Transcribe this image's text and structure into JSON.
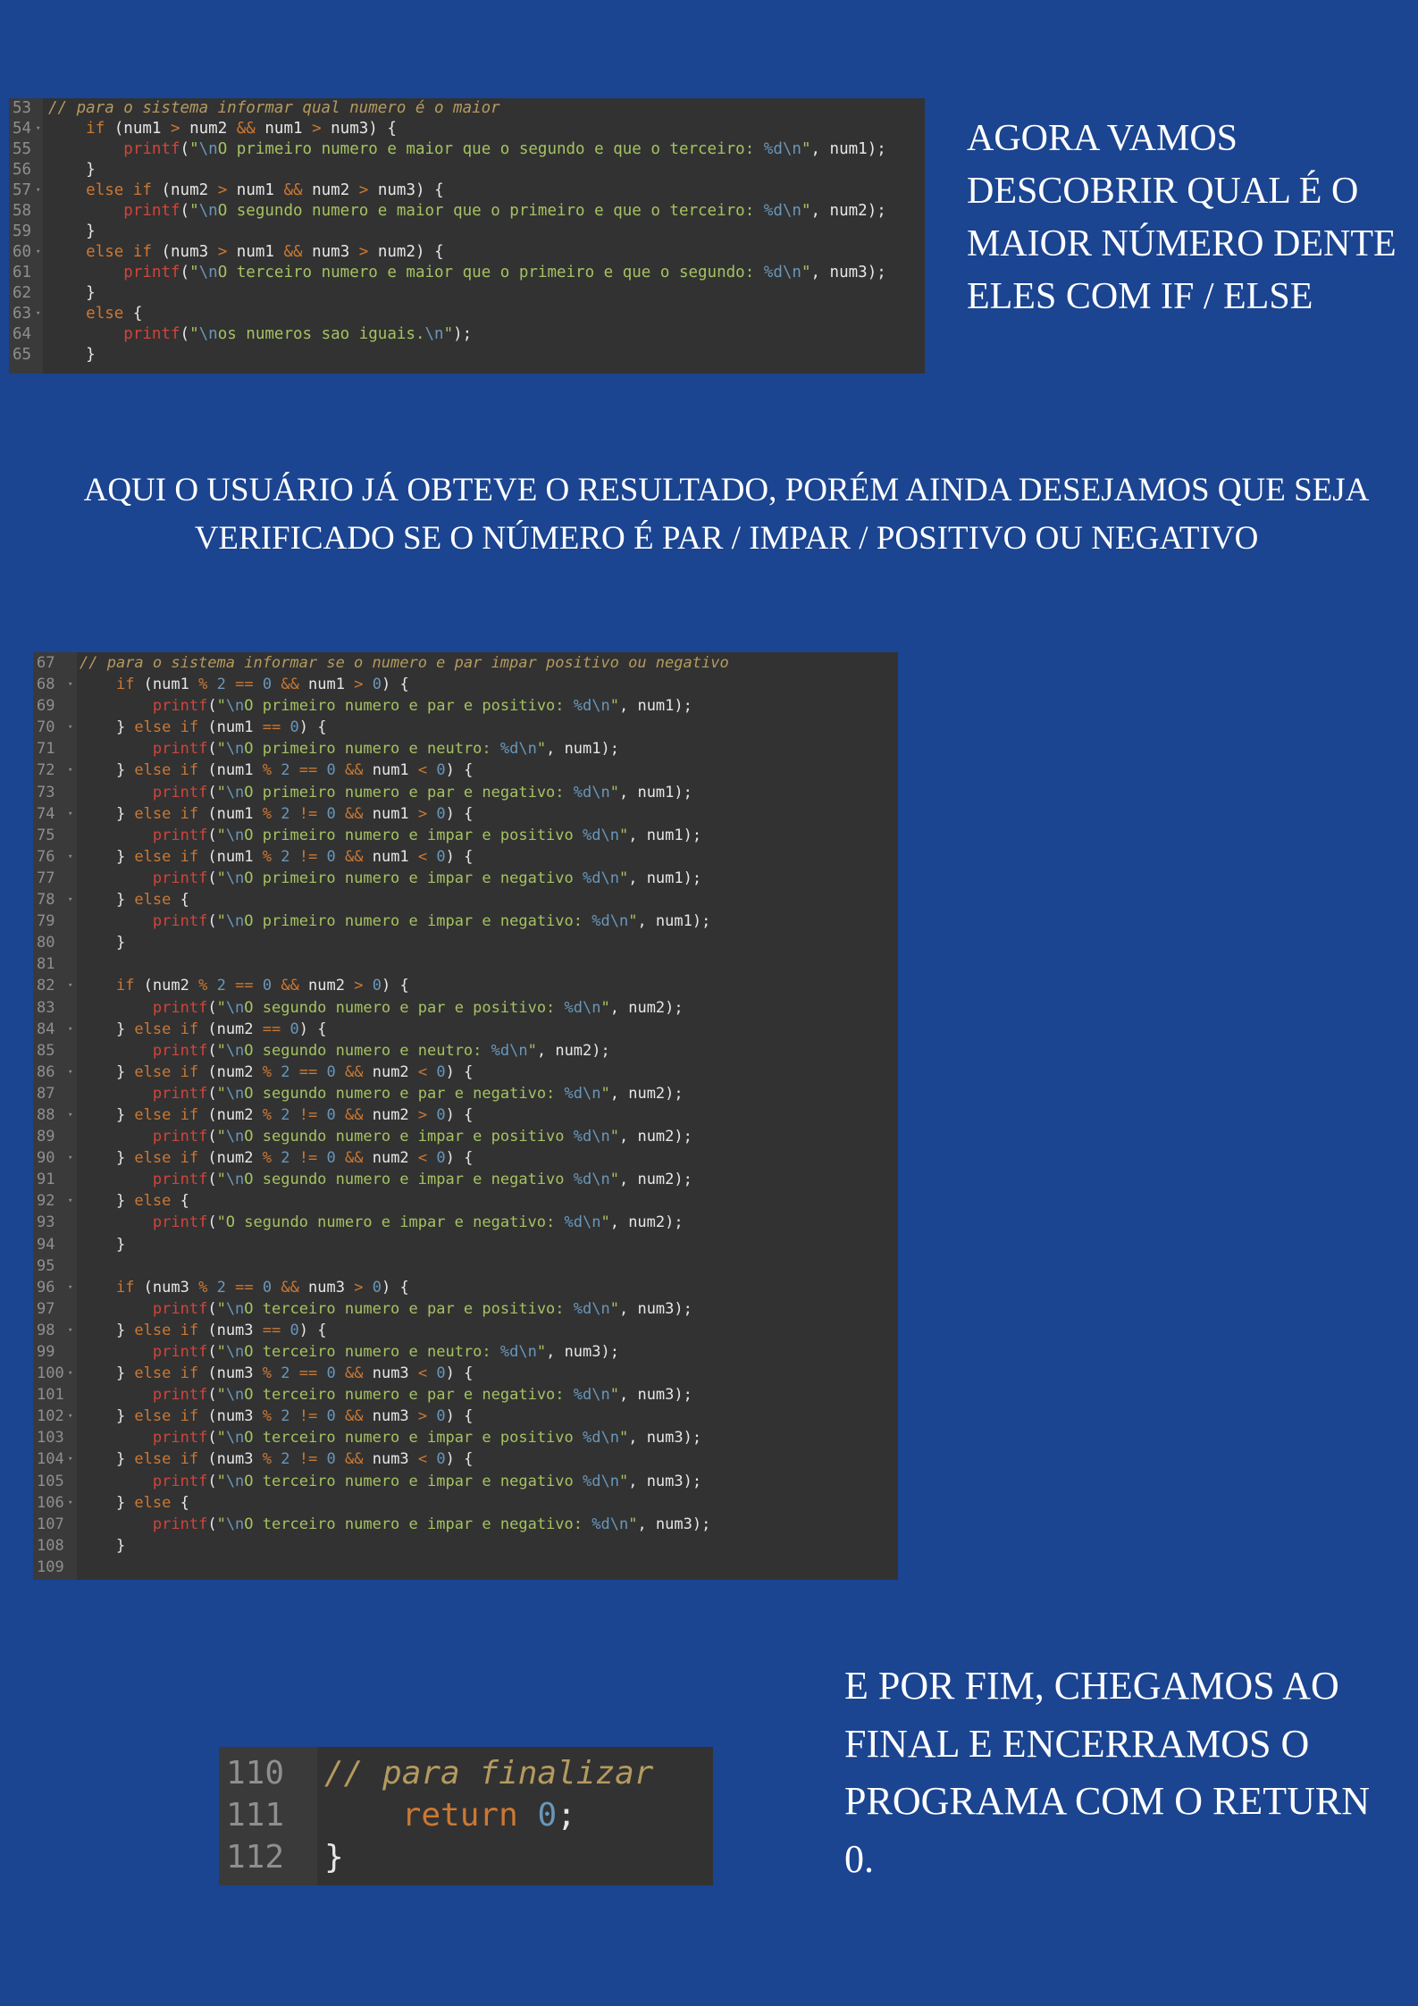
{
  "captions": {
    "top_right": "AGORA VAMOS DESCOBRIR QUAL É O MAIOR NÚMERO DENTE ELES COM IF / ELSE",
    "middle": "AQUI O USUÁRIO JÁ OBTEVE O RESULTADO, PORÉM AINDA DESEJAMOS QUE SEJA VERIFICADO SE O NÚMERO É PAR / IMPAR / POSITIVO OU NEGATIVO",
    "bottom_right": "E POR FIM, CHEGAMOS AO FINAL E ENCERRAMOS O PROGRAMA COM O RETURN 0."
  },
  "colors": {
    "background": "#1b4491",
    "editor": "#323232",
    "keyword": "#cc7832",
    "function": "#d0453a",
    "string": "#a5c261",
    "number": "#6897bb",
    "comment": "#b49a5f"
  },
  "code_blocks": {
    "maior": {
      "start": 53,
      "lines": [
        "// para o sistema informar qual numero é o maior",
        "    if (num1 > num2 && num1 > num3) {",
        "        printf(\"\\nO primeiro numero e maior que o segundo e que o terceiro: %d\\n\", num1);",
        "    }",
        "    else if (num2 > num1 && num2 > num3) {",
        "        printf(\"\\nO segundo numero e maior que o primeiro e que o terceiro: %d\\n\", num2);",
        "    }",
        "    else if (num3 > num1 && num3 > num2) {",
        "        printf(\"\\nO terceiro numero e maior que o primeiro e que o segundo: %d\\n\", num3);",
        "    }",
        "    else {",
        "        printf(\"\\nos numeros sao iguais.\\n\");",
        "    }"
      ]
    },
    "par_impar": {
      "start": 67,
      "lines": [
        "// para o sistema informar se o numero e par impar positivo ou negativo",
        "    if (num1 % 2 == 0 && num1 > 0) {",
        "        printf(\"\\nO primeiro numero e par e positivo: %d\\n\", num1);",
        "    } else if (num1 == 0) {",
        "        printf(\"\\nO primeiro numero e neutro: %d\\n\", num1);",
        "    } else if (num1 % 2 == 0 && num1 < 0) {",
        "        printf(\"\\nO primeiro numero e par e negativo: %d\\n\", num1);",
        "    } else if (num1 % 2 != 0 && num1 > 0) {",
        "        printf(\"\\nO primeiro numero e impar e positivo %d\\n\", num1);",
        "    } else if (num1 % 2 != 0 && num1 < 0) {",
        "        printf(\"\\nO primeiro numero e impar e negativo %d\\n\", num1);",
        "    } else {",
        "        printf(\"\\nO primeiro numero e impar e negativo: %d\\n\", num1);",
        "    }",
        "",
        "    if (num2 % 2 == 0 && num2 > 0) {",
        "        printf(\"\\nO segundo numero e par e positivo: %d\\n\", num2);",
        "    } else if (num2 == 0) {",
        "        printf(\"\\nO segundo numero e neutro: %d\\n\", num2);",
        "    } else if (num2 % 2 == 0 && num2 < 0) {",
        "        printf(\"\\nO segundo numero e par e negativo: %d\\n\", num2);",
        "    } else if (num2 % 2 != 0 && num2 > 0) {",
        "        printf(\"\\nO segundo numero e impar e positivo %d\\n\", num2);",
        "    } else if (num2 % 2 != 0 && num2 < 0) {",
        "        printf(\"\\nO segundo numero e impar e negativo %d\\n\", num2);",
        "    } else {",
        "        printf(\"O segundo numero e impar e negativo: %d\\n\", num2);",
        "    }",
        "",
        "    if (num3 % 2 == 0 && num3 > 0) {",
        "        printf(\"\\nO terceiro numero e par e positivo: %d\\n\", num3);",
        "    } else if (num3 == 0) {",
        "        printf(\"\\nO terceiro numero e neutro: %d\\n\", num3);",
        "    } else if (num3 % 2 == 0 && num3 < 0) {",
        "        printf(\"\\nO terceiro numero e par e negativo: %d\\n\", num3);",
        "    } else if (num3 % 2 != 0 && num3 > 0) {",
        "        printf(\"\\nO terceiro numero e impar e positivo %d\\n\", num3);",
        "    } else if (num3 % 2 != 0 && num3 < 0) {",
        "        printf(\"\\nO terceiro numero e impar e negativo %d\\n\", num3);",
        "    } else {",
        "        printf(\"\\nO terceiro numero e impar e negativo: %d\\n\", num3);",
        "    }",
        ""
      ]
    },
    "final": {
      "start": 110,
      "lines": [
        "// para finalizar",
        "    return 0;",
        "}"
      ]
    }
  }
}
